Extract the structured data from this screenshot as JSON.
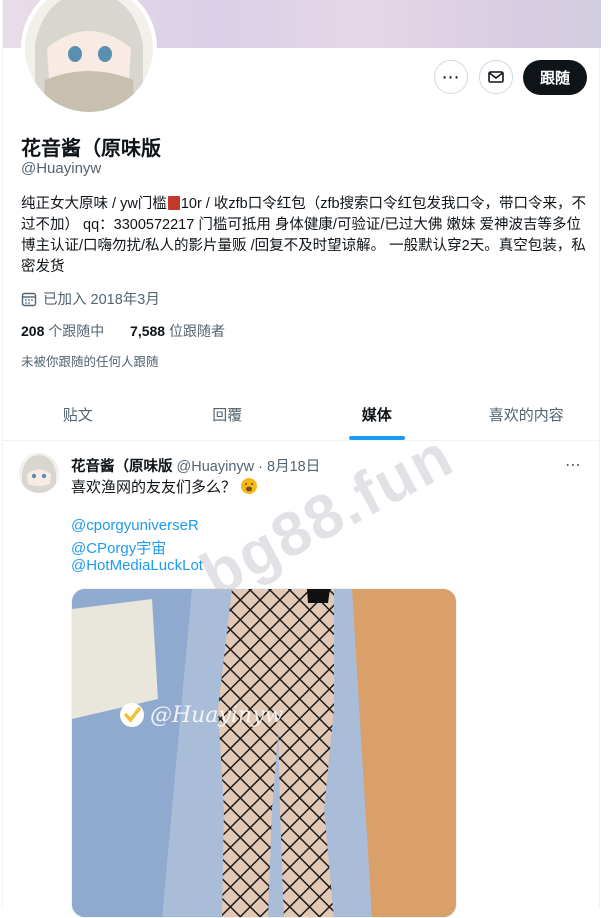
{
  "profile": {
    "display_name": "花音酱（原味版",
    "handle": "@Huayinyw",
    "bio_before_icon": "纯正女大原味 / yw门槛",
    "bio_after_icon": "10r / 收zfb口令红包（zfb搜索口令红包发我口令，带口令来，不过不加） qq：3300572217 门槛可抵用 身体健康/可验证/已过大佛 嫩妹 爱神波吉等多位博主认证/口嗨勿扰/私人的影片量贩 /回复不及时望谅解。 一般默认穿2天。真空包装，私密发货",
    "joined": "已加入 2018年3月",
    "following_count": "208",
    "following_label": "个跟随中",
    "followers_count": "7,588",
    "followers_label": "位跟随者",
    "not_followed_note": "未被你跟随的任何人跟随",
    "follow_label": "跟随"
  },
  "tabs": [
    {
      "label": "贴文"
    },
    {
      "label": "回覆"
    },
    {
      "label": "媒体"
    },
    {
      "label": "喜欢的内容"
    }
  ],
  "post": {
    "author_name": "花音酱（原味版",
    "author_handle": "@Huayinyw",
    "separator": "·",
    "date": "8月18日",
    "text": "喜欢渔网的友友们多么？",
    "mentions": [
      "@cporgyuniverseR",
      "@CPorgy宇宙",
      "@HotMediaLuckLot"
    ],
    "image_caption": "@Huayinyw"
  },
  "watermark": "bg88.fun",
  "icons": {
    "more": "more-icon",
    "mail": "mail-icon",
    "calendar": "calendar-icon",
    "verified": "check-badge-icon"
  },
  "colors": {
    "accent": "#1d9bf0",
    "follow_bg": "#0f1419",
    "muted": "#536471"
  }
}
